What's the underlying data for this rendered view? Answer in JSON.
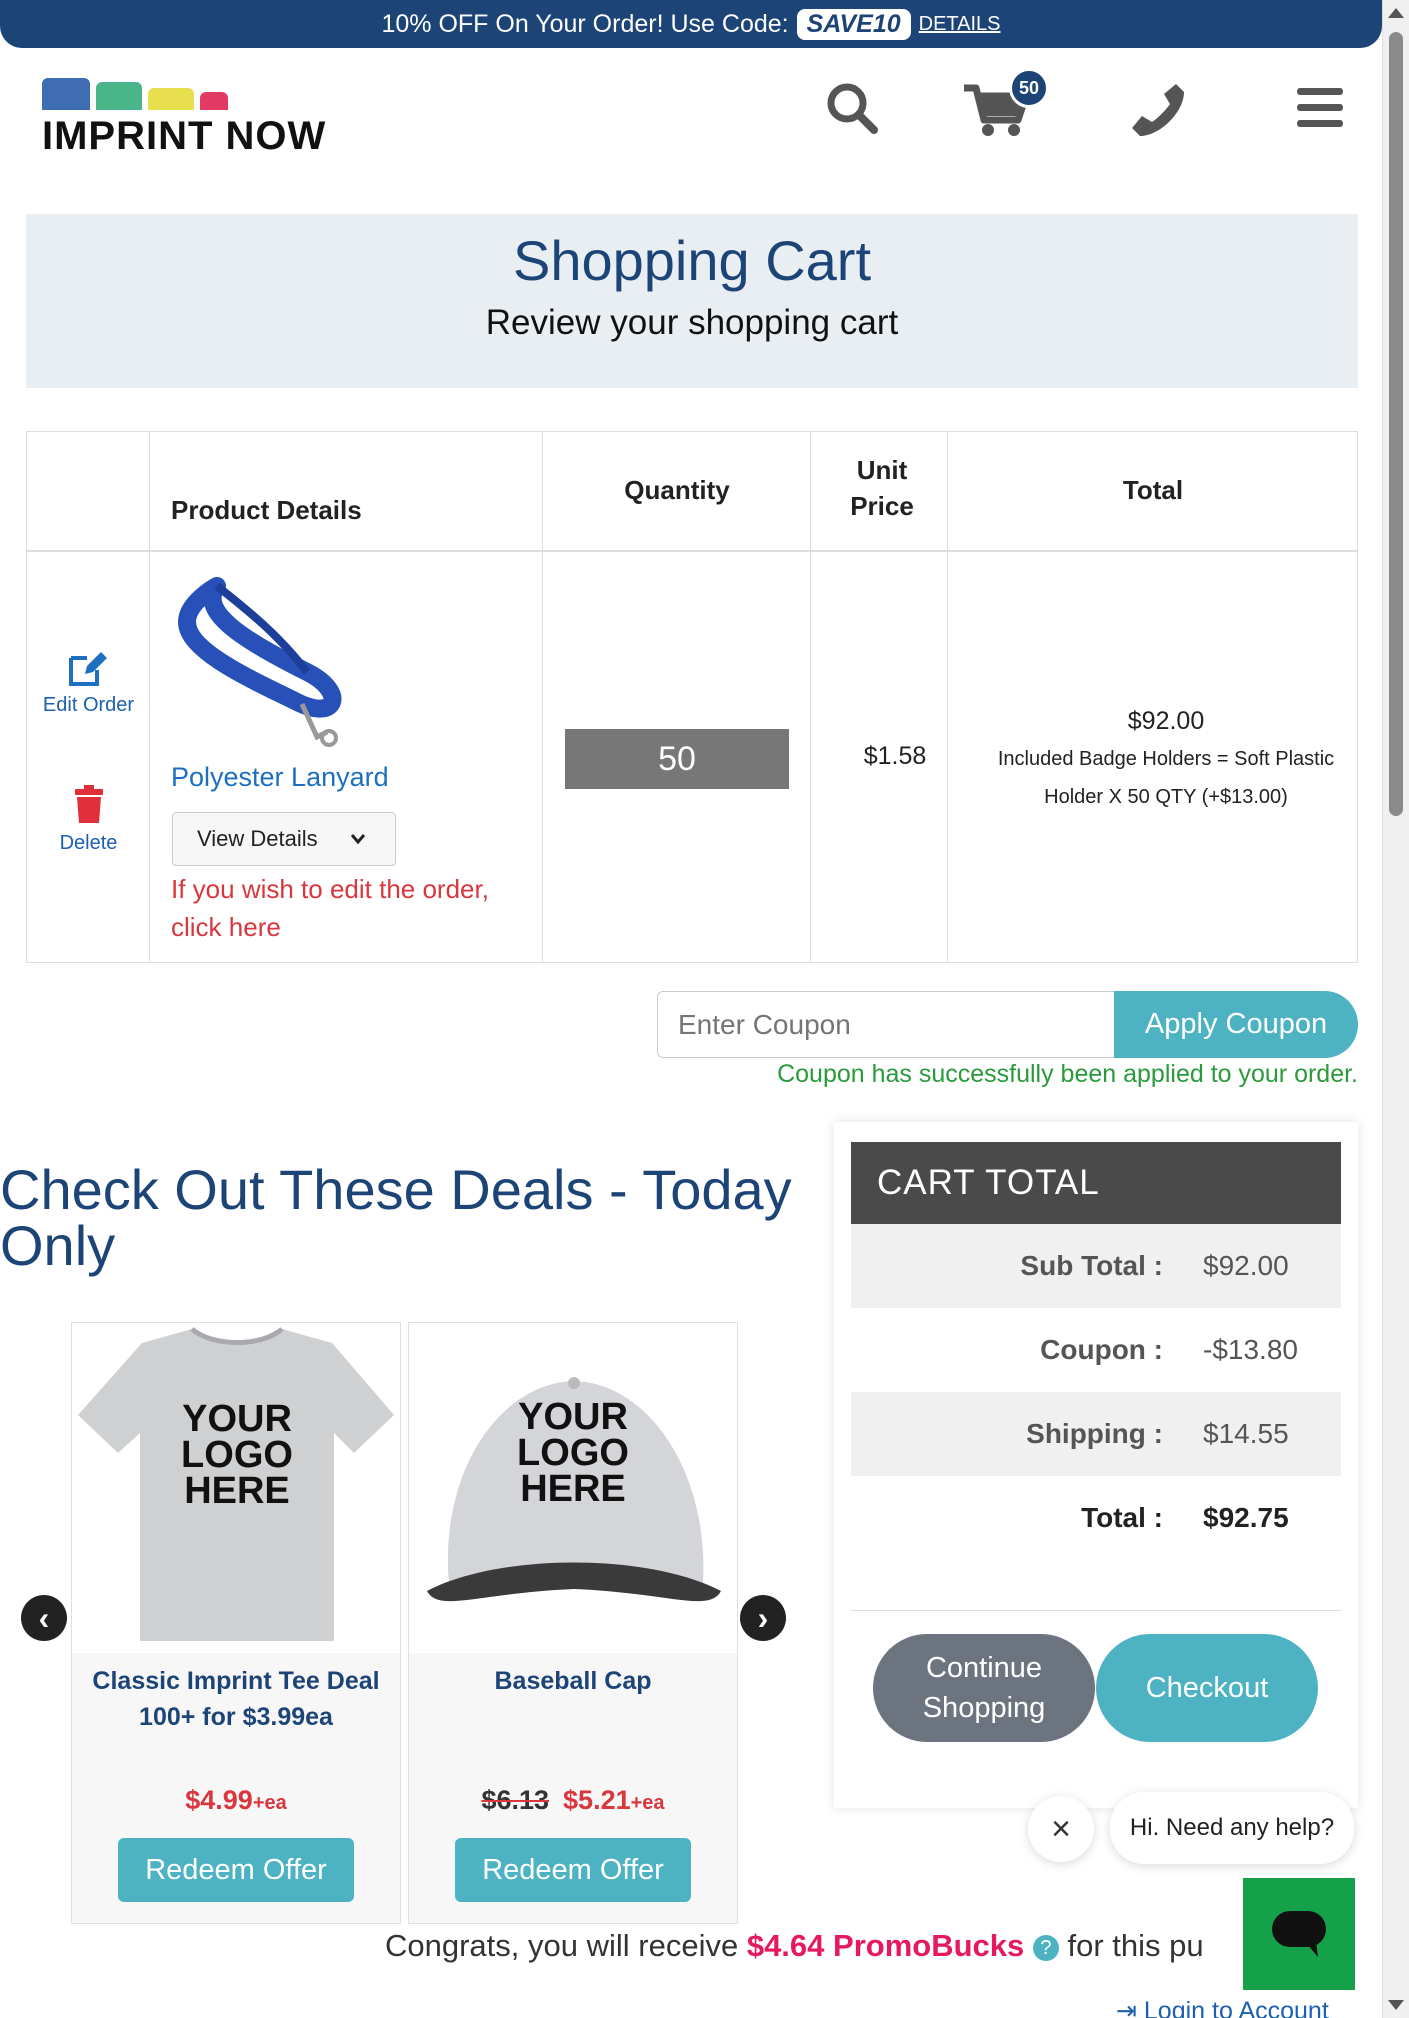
{
  "promo": {
    "text": "10% OFF On Your Order! Use Code:",
    "code": "SAVE10",
    "details": "DETAILS"
  },
  "header": {
    "logo": "IMPRINT NOW",
    "cart_count": "50",
    "logo_colors": [
      "#3f6db3",
      "#4bb58a",
      "#e8df4f",
      "#e13a64"
    ]
  },
  "page": {
    "title": "Shopping Cart",
    "subtitle": "Review your shopping cart"
  },
  "cart": {
    "headers": {
      "product": "Product Details",
      "quantity": "Quantity",
      "unit_price": "Unit Price",
      "total": "Total"
    },
    "actions": {
      "edit": "Edit Order",
      "delete": "Delete"
    },
    "item": {
      "name": "Polyester Lanyard",
      "view_details": "View Details",
      "edit_note": "If you wish to edit the order,",
      "edit_link": "click here",
      "quantity": "50",
      "unit_price": "$1.58",
      "total": "$92.00",
      "extra": "Included Badge Holders = Soft Plastic Holder X 50 QTY (+$13.00)"
    }
  },
  "coupon": {
    "placeholder": "Enter Coupon",
    "button": "Apply Coupon",
    "message": "Coupon has successfully been applied to your order."
  },
  "deals": {
    "title": "Check Out These Deals - Today Only",
    "items": [
      {
        "image_text": "YOUR LOGO HERE",
        "name": "Classic Imprint Tee Deal 100+ for $3.99ea",
        "old_price": "",
        "price": "$4.99",
        "suffix": "+ea",
        "button": "Redeem Offer"
      },
      {
        "image_text": "YOUR LOGO HERE",
        "name": "Baseball Cap",
        "old_price": "$6.13",
        "price": "$5.21",
        "suffix": "+ea",
        "button": "Redeem Offer"
      }
    ]
  },
  "cart_total": {
    "title": "CART  TOTAL",
    "rows": [
      {
        "label": "Sub Total :",
        "value": "$92.00"
      },
      {
        "label": "Coupon :",
        "value": "-$13.80"
      },
      {
        "label": "Shipping :",
        "value": "$14.55"
      },
      {
        "label": "Total :",
        "value": "$92.75"
      }
    ],
    "continue": "Continue Shopping",
    "checkout": "Checkout"
  },
  "chat": {
    "greeting": "Hi. Need any help?"
  },
  "promobucks": {
    "prefix": "Congrats, you will receive",
    "amount": "$4.64 PromoBucks",
    "suffix": "for this pu"
  },
  "login": "Login to Account",
  "colors": {
    "brand": "#1d4477",
    "accent": "#4db3c3",
    "alert": "#d9363e",
    "success": "#2a9a3a",
    "chat": "#14a14a"
  }
}
